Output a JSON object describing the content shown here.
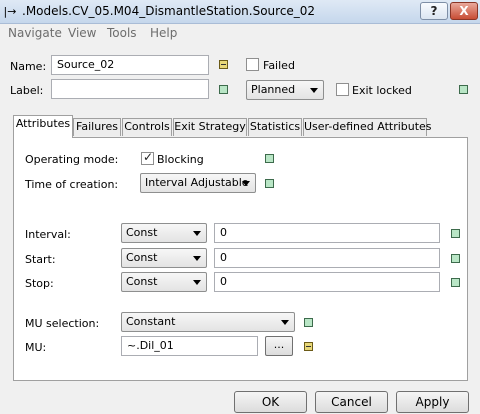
{
  "window": {
    "title": ".Models.CV_05.M04_DismantleStation.Source_02",
    "help_glyph": "?",
    "close_glyph": "X",
    "icon_glyph": "|→"
  },
  "menu": {
    "items": [
      "Navigate",
      "View",
      "Tools",
      "Help"
    ]
  },
  "header": {
    "name_label": "Name:",
    "name_value": "Source_02",
    "label_label": "Label:",
    "label_value": "",
    "failed_label": "Failed",
    "failed_checked": false,
    "state_value": "Planned",
    "exit_locked_label": "Exit locked",
    "exit_locked_checked": false
  },
  "tabs": [
    "Attributes",
    "Failures",
    "Controls",
    "Exit Strategy",
    "Statistics",
    "User-defined Attributes"
  ],
  "attributes": {
    "operating_mode_label": "Operating mode:",
    "blocking_label": "Blocking",
    "blocking_checked": true,
    "time_of_creation_label": "Time of creation:",
    "time_of_creation_value": "Interval Adjustable",
    "interval_label": "Interval:",
    "interval_dist": "Const",
    "interval_value": "0",
    "start_label": "Start:",
    "start_dist": "Const",
    "start_value": "0",
    "stop_label": "Stop:",
    "stop_dist": "Const",
    "stop_value": "0",
    "mu_selection_label": "MU selection:",
    "mu_selection_value": "Constant",
    "mu_label": "MU:",
    "mu_value": "~.Dil_01",
    "mu_browse_label": "..."
  },
  "buttons": {
    "ok": "OK",
    "cancel": "Cancel",
    "apply": "Apply"
  },
  "colors": {
    "indicator_green": "#b9e6c6",
    "indicator_yellow": "#e8d878",
    "titlebar": "#c5d7ec"
  }
}
